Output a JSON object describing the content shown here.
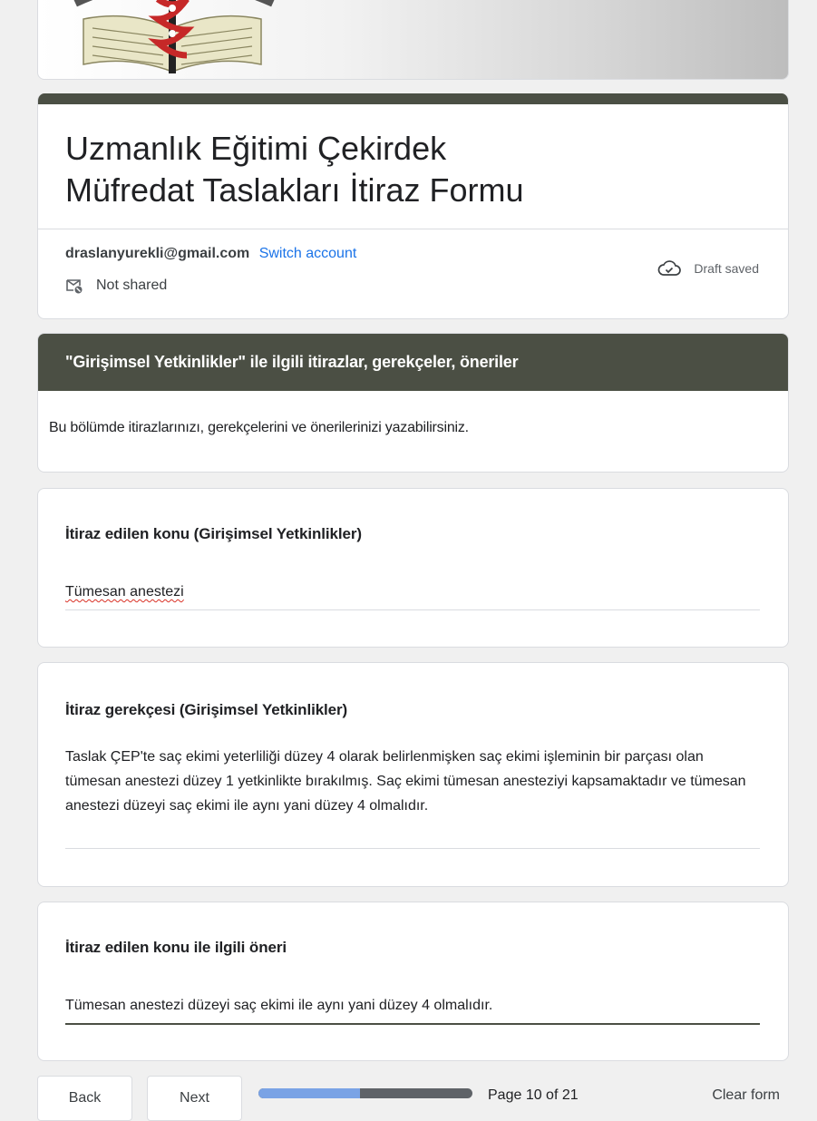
{
  "form": {
    "title_line1": "Uzmanlık Eğitimi Çekirdek",
    "title_line2": "Müfredat Taslakları İtiraz Formu"
  },
  "account": {
    "email": "draslanyurekli@gmail.com",
    "switch_label": "Switch account",
    "not_shared": "Not shared",
    "draft_status": "Draft saved"
  },
  "section": {
    "header": "\"Girişimsel Yetkinlikler\" ile ilgili itirazlar, gerekçeler, öneriler",
    "description": "Bu bölümde itirazlarınızı, gerekçelerini ve önerilerinizi yazabilirsiniz."
  },
  "questions": [
    {
      "title": "İtiraz edilen konu (Girişimsel Yetkinlikler)",
      "answer": "Tümesan anestezi"
    },
    {
      "title": "İtiraz gerekçesi (Girişimsel Yetkinlikler)",
      "answer": "Taslak ÇEP'te saç ekimi yeterliliği düzey 4 olarak belirlenmişken saç ekimi işleminin bir parçası olan tümesan anestezi düzey 1 yetkinlikte bırakılmış. Saç ekimi tümesan anesteziyi kapsamaktadır ve tümesan anestezi düzeyi saç ekimi ile aynı yani düzey 4 olmalıdır."
    },
    {
      "title": "İtiraz edilen konu ile ilgili öneri",
      "answer": "Tümesan anestezi düzeyi saç ekimi ile aynı yani düzey 4 olmalıdır."
    }
  ],
  "nav": {
    "back_label": "Back",
    "next_label": "Next",
    "page_label": "Page 10 of 21",
    "progress_fraction": 0.476,
    "clear_label": "Clear form"
  },
  "colors": {
    "theme": "#4b4f44",
    "link": "#1a73e8",
    "progress_fill": "#7aa3e5",
    "progress_track": "#5f6368",
    "spell_error": "#d93025"
  },
  "icons": {
    "logo": "medical-caduceus-book-logo",
    "not_shared": "mail-not-shared-icon",
    "draft": "cloud-check-icon"
  }
}
